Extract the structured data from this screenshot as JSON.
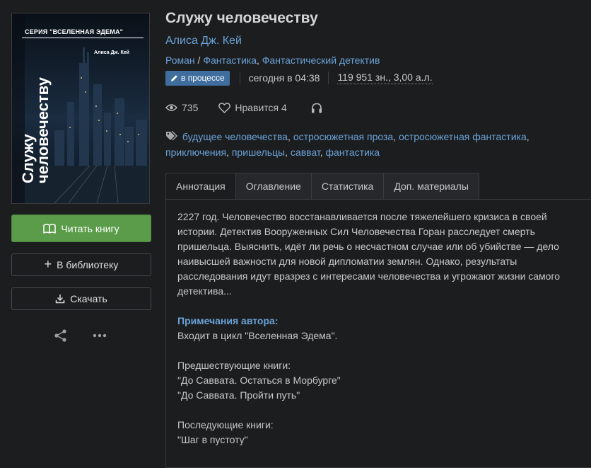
{
  "book": {
    "title": "Служу человечеству",
    "author": "Алиса Дж. Кей",
    "genres": [
      "Роман",
      "Фантастика",
      "Фантастический детектив"
    ],
    "status": "в процессе",
    "updated": "сегодня в 04:38",
    "size": "119 951 зн., 3,00 а.л.",
    "views": "735",
    "likes_label": "Нравится 4",
    "tags": [
      "будущее человечества",
      "остросюжетная проза",
      "остросюжетная фантастика",
      "приключения",
      "пришельцы",
      "савват",
      "фантастика"
    ]
  },
  "cover": {
    "series": "СЕРИЯ \"ВСЕЛЕННАЯ ЭДЕМА\"",
    "author": "Алиса Дж. Кей",
    "title_line1": "Служу",
    "title_line2": "человечеству"
  },
  "actions": {
    "read": "Читать книгу",
    "library": "В библиотеку",
    "download": "Скачать"
  },
  "tabs": [
    "Аннотация",
    "Оглавление",
    "Статистика",
    "Доп. материалы"
  ],
  "annotation": {
    "text": "2227 год. Человечество восстанавливается после тяжелейшего кризиса в своей истории. Детектив Вооруженных Сил Человечества Горан расследует смерть пришельца. Выяснить, идёт ли речь о несчастном случае или об убийстве — дело наивысшей важности для новой дипломатии землян. Однако, результаты расследования идут вразрез с интересами человечества и угрожают жизни самого детектива...",
    "notes_title": "Примечания автора:",
    "notes_line": "Входит в цикл \"Вселенная Эдема\".",
    "prev_title": "Предшествующие книги:",
    "prev_books": [
      "\"До Саввата. Остаться в Морбурге\"",
      "\"До Саввата. Пройти путь\""
    ],
    "next_title": "Последующие книги:",
    "next_books": [
      "\"Шаг в пустоту\""
    ]
  },
  "colors": {
    "background": "#1c1d1f",
    "link": "#6aa3d9",
    "read_button": "#5a9c4a",
    "status_badge": "#3f6e9e"
  }
}
